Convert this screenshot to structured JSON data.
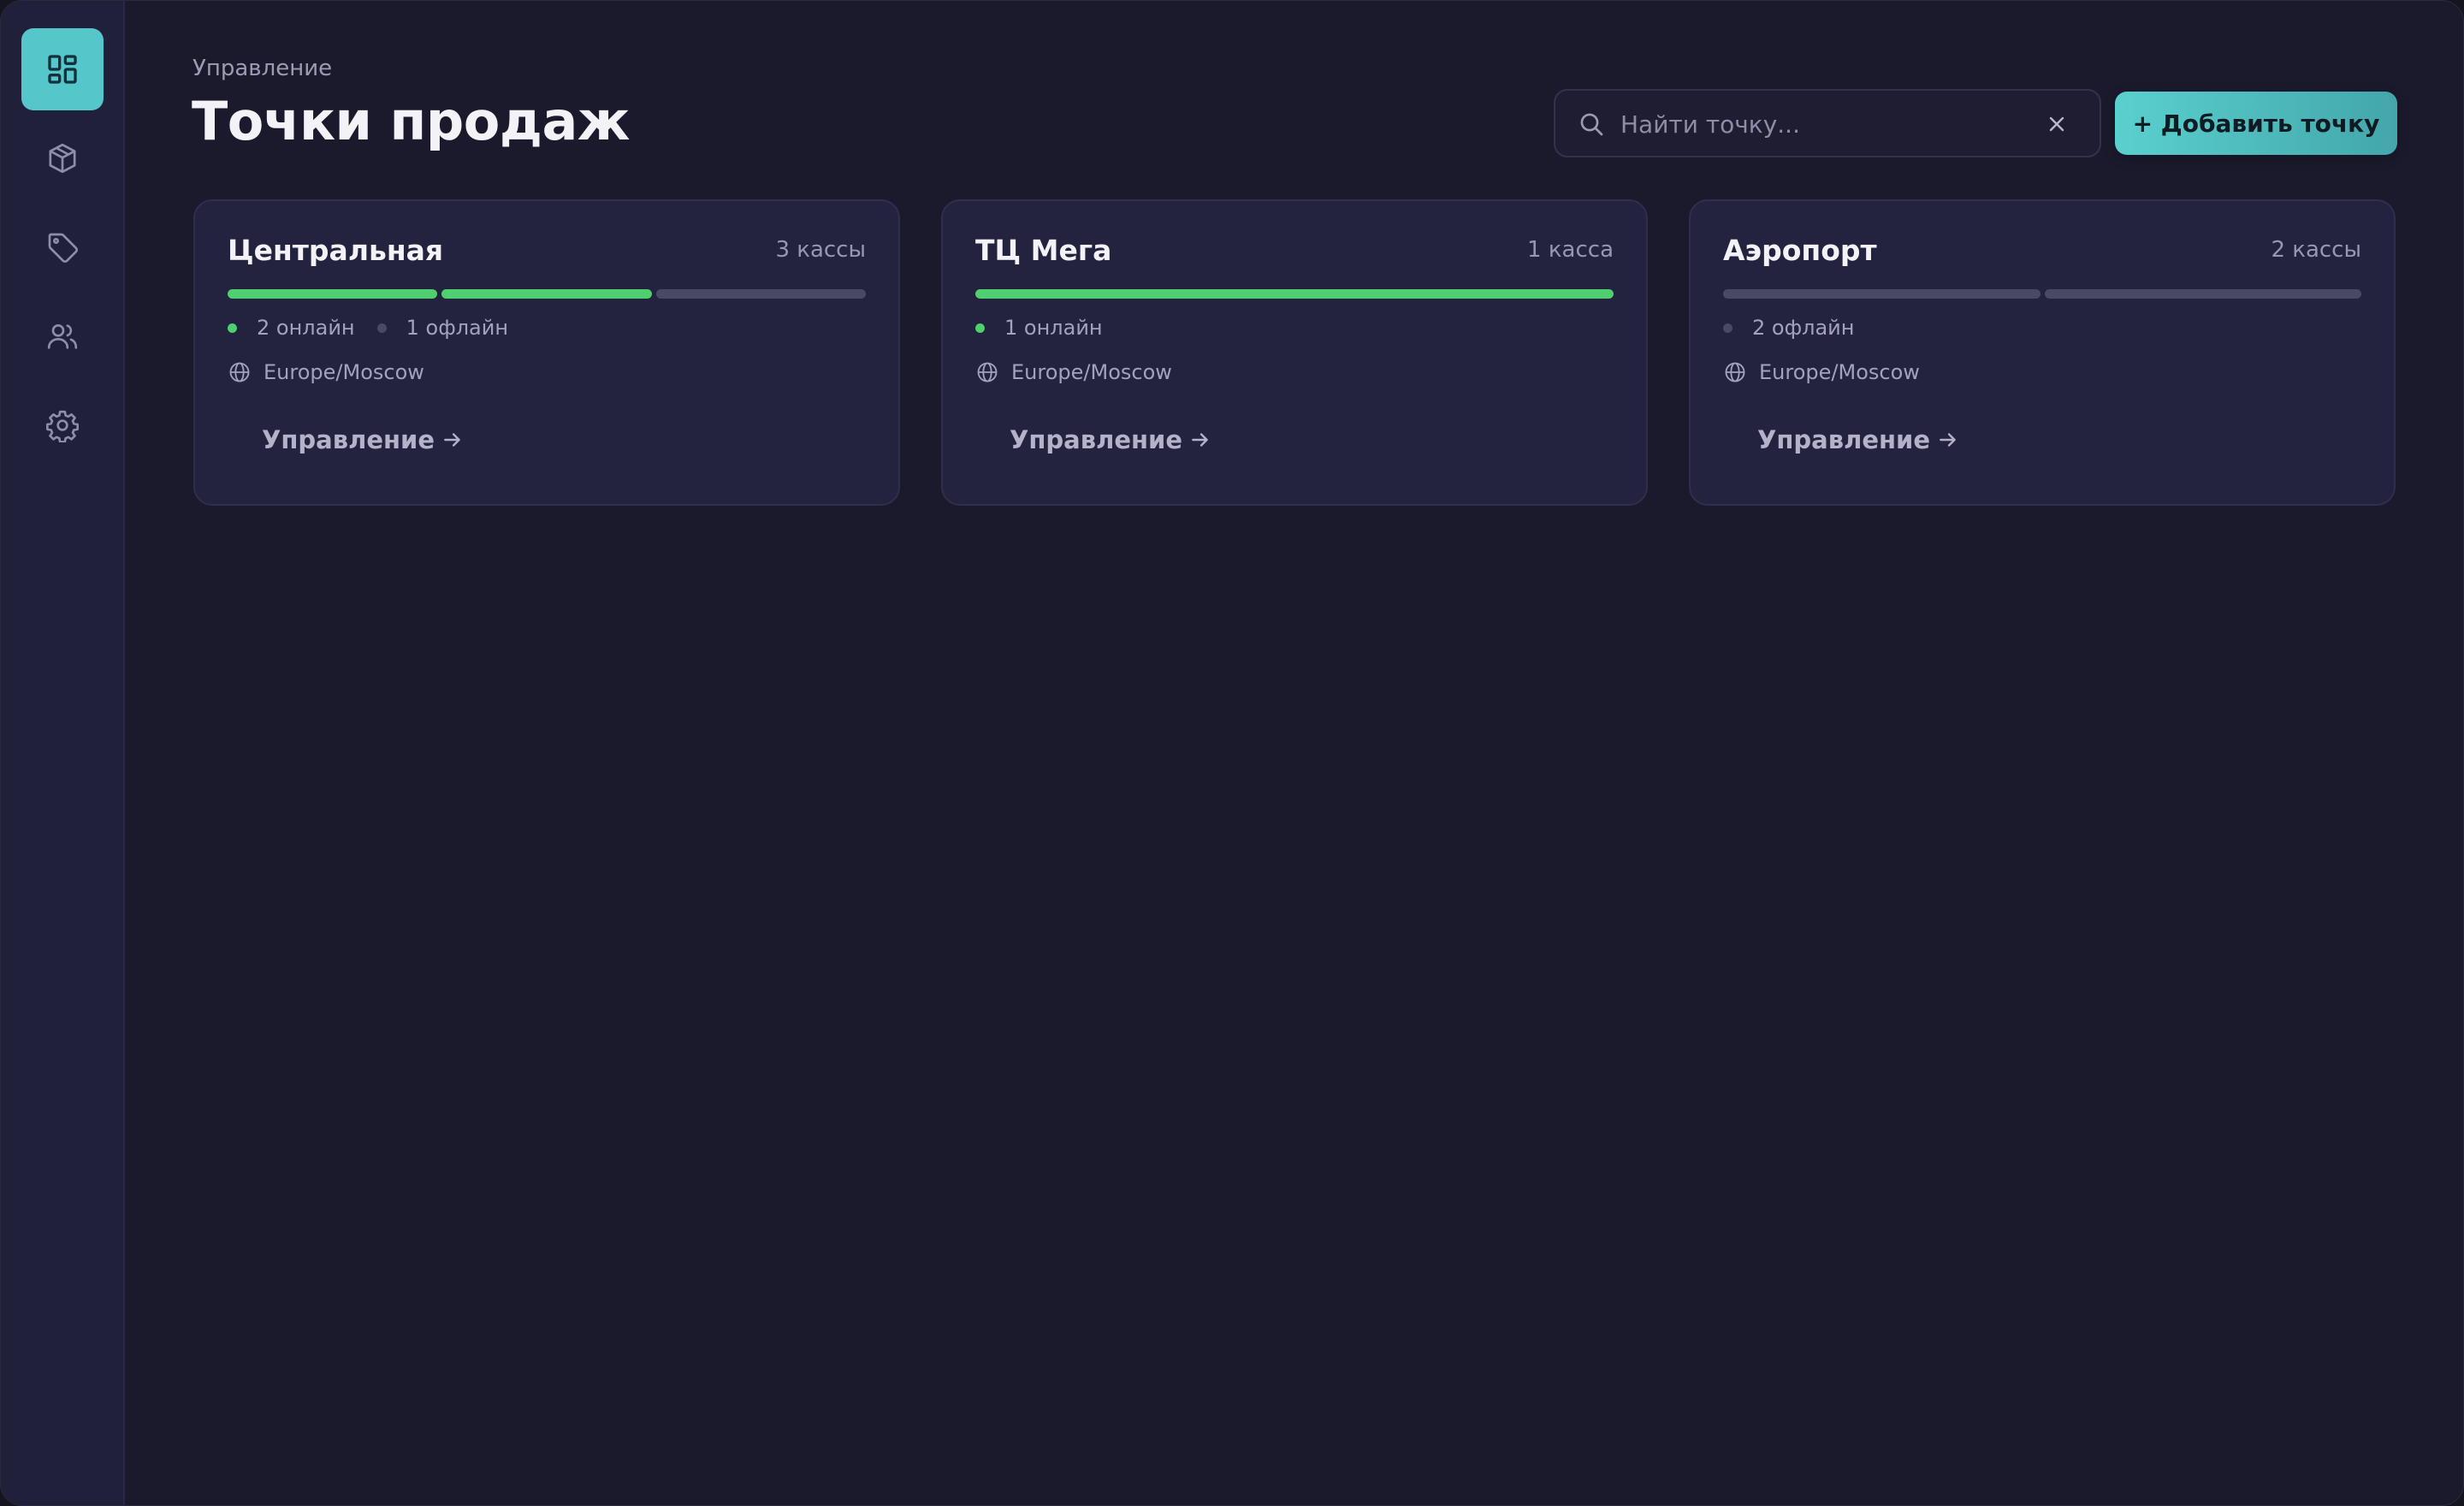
{
  "sidebar": {
    "items": [
      {
        "icon": "dashboard-icon",
        "active": true
      },
      {
        "icon": "box-icon",
        "active": false
      },
      {
        "icon": "tag-icon",
        "active": false
      },
      {
        "icon": "users-icon",
        "active": false
      },
      {
        "icon": "gear-icon",
        "active": false
      }
    ]
  },
  "header": {
    "breadcrumb": "Управление",
    "title": "Точки продаж",
    "search_placeholder": "Найти точку...",
    "search_value": "",
    "add_button": "+ Добавить точку"
  },
  "colors": {
    "accent": "#55c6c9",
    "online": "#4fcf6e",
    "offline": "#4a4963"
  },
  "stores": [
    {
      "name": "Центральная",
      "count_label": "3 кассы",
      "registers": [
        "online",
        "online",
        "offline"
      ],
      "online_label": "2 онлайн",
      "offline_label": "1 офлайн",
      "timezone": "Europe/Moscow",
      "manage_label": "Управление"
    },
    {
      "name": "ТЦ Мега",
      "count_label": "1 касса",
      "registers": [
        "online"
      ],
      "online_label": "1 онлайн",
      "offline_label": "",
      "timezone": "Europe/Moscow",
      "manage_label": "Управление"
    },
    {
      "name": "Аэропорт",
      "count_label": "2 кассы",
      "registers": [
        "offline",
        "offline"
      ],
      "online_label": "",
      "offline_label": "2 офлайн",
      "timezone": "Europe/Moscow",
      "manage_label": "Управление"
    }
  ]
}
